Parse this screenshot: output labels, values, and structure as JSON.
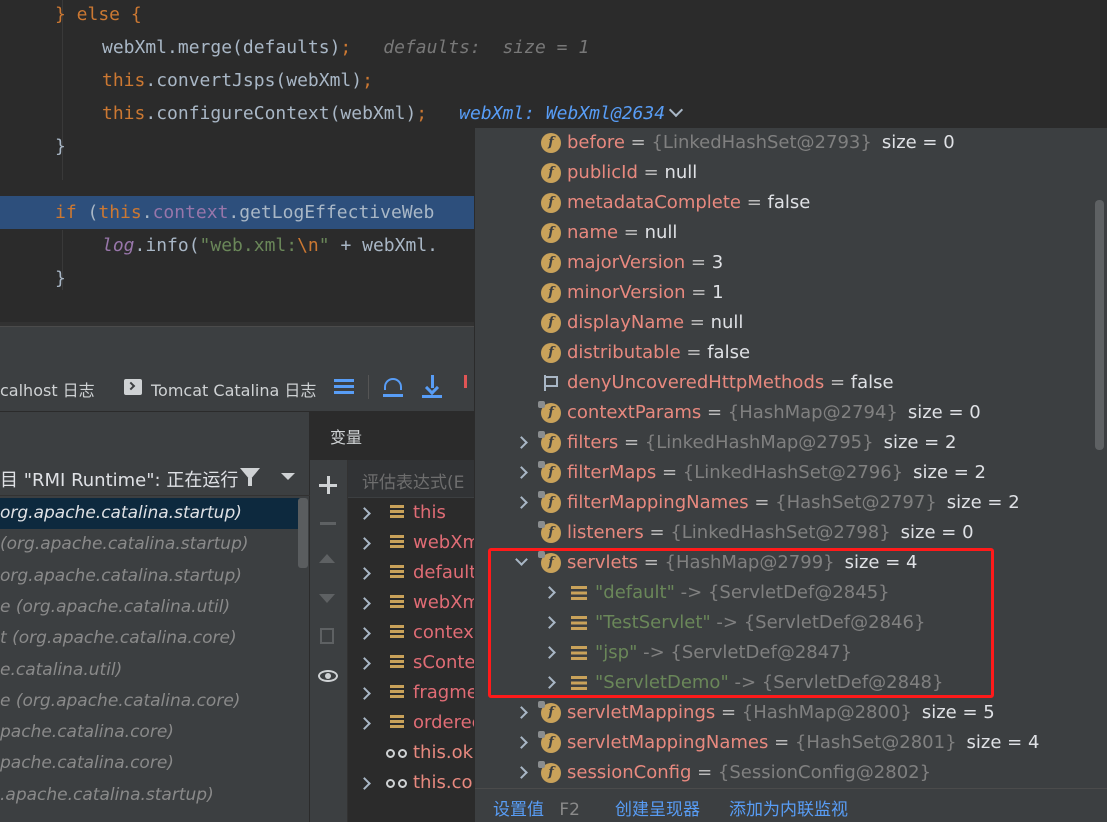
{
  "editor": {
    "lines": [
      {
        "segments": [
          [
            "kw",
            "} else {"
          ]
        ]
      },
      {
        "segments": [
          [
            "plain",
            "webXml.merge(defaults)"
          ],
          [
            "kw",
            ";"
          ]
        ],
        "hint": "defaults:  size = 1"
      },
      {
        "segments": [
          [
            "kw",
            "this"
          ],
          [
            "plain",
            ".convertJsps(webXml)"
          ],
          [
            "kw",
            ";"
          ]
        ]
      },
      {
        "segments": [
          [
            "kw",
            "this"
          ],
          [
            "plain",
            ".configureContext(webXml)"
          ],
          [
            "kw",
            ";"
          ]
        ],
        "hint_blue": "webXml: WebXml@2634"
      },
      {
        "segments": [
          [
            "plain",
            "}"
          ]
        ]
      },
      {
        "segments": []
      },
      {
        "segments": [
          [
            "kw",
            "if "
          ],
          [
            "plain",
            "("
          ],
          [
            "kw",
            "this"
          ],
          [
            "plain",
            "."
          ],
          [
            "fld",
            "context"
          ],
          [
            "plain",
            ".getLogEffectiveWeb"
          ]
        ]
      },
      {
        "segments": [
          [
            "log",
            "log"
          ],
          [
            "plain",
            ".info("
          ],
          [
            "str",
            "\"web.xml:"
          ],
          [
            "esc",
            "\\n"
          ],
          [
            "str",
            "\""
          ],
          [
            "plain",
            " + webXml."
          ]
        ]
      },
      {
        "segments": [
          [
            "plain",
            "}"
          ]
        ]
      }
    ]
  },
  "debug_tabs": {
    "localhost_log": "calhost 日志",
    "catalina_log": "Tomcat Catalina 日志"
  },
  "frames": {
    "thread_label": "目 \"RMI Runtime\": 正在运行",
    "items": [
      "org.apache.catalina.startup)",
      "(org.apache.catalina.startup)",
      "org.apache.catalina.startup)",
      "e (org.apache.catalina.util)",
      "t (org.apache.catalina.core)",
      "e.catalina.util)",
      "e (org.apache.catalina.core)",
      "pache.catalina.core)",
      "pache.catalina.core)",
      ".apache.catalina.startup)"
    ]
  },
  "vars": {
    "title": "变量",
    "eval_placeholder": "评估表达式(E",
    "rows": [
      {
        "icon": "list",
        "name": "this",
        "suffix": " = {",
        "expandable": true
      },
      {
        "icon": "list",
        "name": "webXm",
        "suffix": "",
        "expandable": true
      },
      {
        "icon": "list",
        "name": "default",
        "suffix": "",
        "expandable": true
      },
      {
        "icon": "list",
        "name": "webXm",
        "suffix": "",
        "expandable": true
      },
      {
        "icon": "list",
        "name": "context",
        "suffix": "",
        "expandable": true
      },
      {
        "icon": "list",
        "name": "sConte",
        "suffix": "",
        "expandable": true
      },
      {
        "icon": "list",
        "name": "fragme",
        "suffix": "",
        "expandable": true
      },
      {
        "icon": "list",
        "name": "orderec",
        "suffix": "",
        "expandable": true
      },
      {
        "icon": "watch",
        "name": "this.ok",
        "suffix": "",
        "expandable": false
      },
      {
        "icon": "watch",
        "name": "this.co",
        "suffix": "",
        "expandable": true
      }
    ]
  },
  "popup": {
    "rows": [
      {
        "indent": 0,
        "icon": "f",
        "name": "before",
        "ref": "{LinkedHashSet@2793}",
        "extra": "size = 0"
      },
      {
        "indent": 0,
        "icon": "f",
        "name": "publicId",
        "val": "null"
      },
      {
        "indent": 0,
        "icon": "f",
        "name": "metadataComplete",
        "val": "false"
      },
      {
        "indent": 0,
        "icon": "f",
        "name": "name",
        "val": "null"
      },
      {
        "indent": 0,
        "icon": "f",
        "name": "majorVersion",
        "val": "3"
      },
      {
        "indent": 0,
        "icon": "f",
        "name": "minorVersion",
        "val": "1"
      },
      {
        "indent": 0,
        "icon": "f",
        "name": "displayName",
        "val": "null"
      },
      {
        "indent": 0,
        "icon": "f",
        "name": "distributable",
        "val": "false"
      },
      {
        "indent": 0,
        "icon": "flag",
        "name": "denyUncoveredHttpMethods",
        "val": "false"
      },
      {
        "indent": 0,
        "icon": "f-lock",
        "name": "contextParams",
        "ref": "{HashMap@2794}",
        "extra": "size = 0"
      },
      {
        "indent": 0,
        "icon": "f-lock",
        "expand": "closed",
        "name": "filters",
        "ref": "{LinkedHashMap@2795}",
        "extra": "size = 2"
      },
      {
        "indent": 0,
        "icon": "f-lock",
        "expand": "closed",
        "name": "filterMaps",
        "ref": "{LinkedHashSet@2796}",
        "extra": "size = 2"
      },
      {
        "indent": 0,
        "icon": "f-lock",
        "expand": "closed",
        "name": "filterMappingNames",
        "ref": "{HashSet@2797}",
        "extra": "size = 2"
      },
      {
        "indent": 0,
        "icon": "f-lock",
        "name": "listeners",
        "ref": "{LinkedHashSet@2798}",
        "extra": "size = 0"
      },
      {
        "indent": 0,
        "icon": "f-lock",
        "expand": "open",
        "name": "servlets",
        "ref": "{HashMap@2799}",
        "extra": "size = 4"
      },
      {
        "indent": 1,
        "icon": "bars",
        "expand": "closed",
        "key": "\"default\"",
        "ref": "{ServletDef@2845}"
      },
      {
        "indent": 1,
        "icon": "bars",
        "expand": "closed",
        "key": "\"TestServlet\"",
        "ref": "{ServletDef@2846}"
      },
      {
        "indent": 1,
        "icon": "bars",
        "expand": "closed",
        "key": "\"jsp\"",
        "ref": "{ServletDef@2847}"
      },
      {
        "indent": 1,
        "icon": "bars",
        "expand": "closed",
        "key": "\"ServletDemo\"",
        "ref": "{ServletDef@2848}"
      },
      {
        "indent": 0,
        "icon": "f-lock",
        "expand": "closed",
        "name": "servletMappings",
        "ref": "{HashMap@2800}",
        "extra": "size = 5"
      },
      {
        "indent": 0,
        "icon": "f-lock",
        "expand": "closed",
        "name": "servletMappingNames",
        "ref": "{HashSet@2801}",
        "extra": "size = 4"
      },
      {
        "indent": 0,
        "icon": "f-lock",
        "expand": "closed",
        "name": "sessionConfig",
        "ref": "{SessionConfig@2802}"
      }
    ],
    "footer": {
      "set_value": "设置值",
      "set_value_key": "F2",
      "create_renderer": "创建呈现器",
      "add_inline_watch": "添加为内联监视"
    }
  },
  "colors": {
    "highlight_box": "#ff1a1a",
    "selection": "#2d4f7c",
    "link": "#589df6"
  }
}
